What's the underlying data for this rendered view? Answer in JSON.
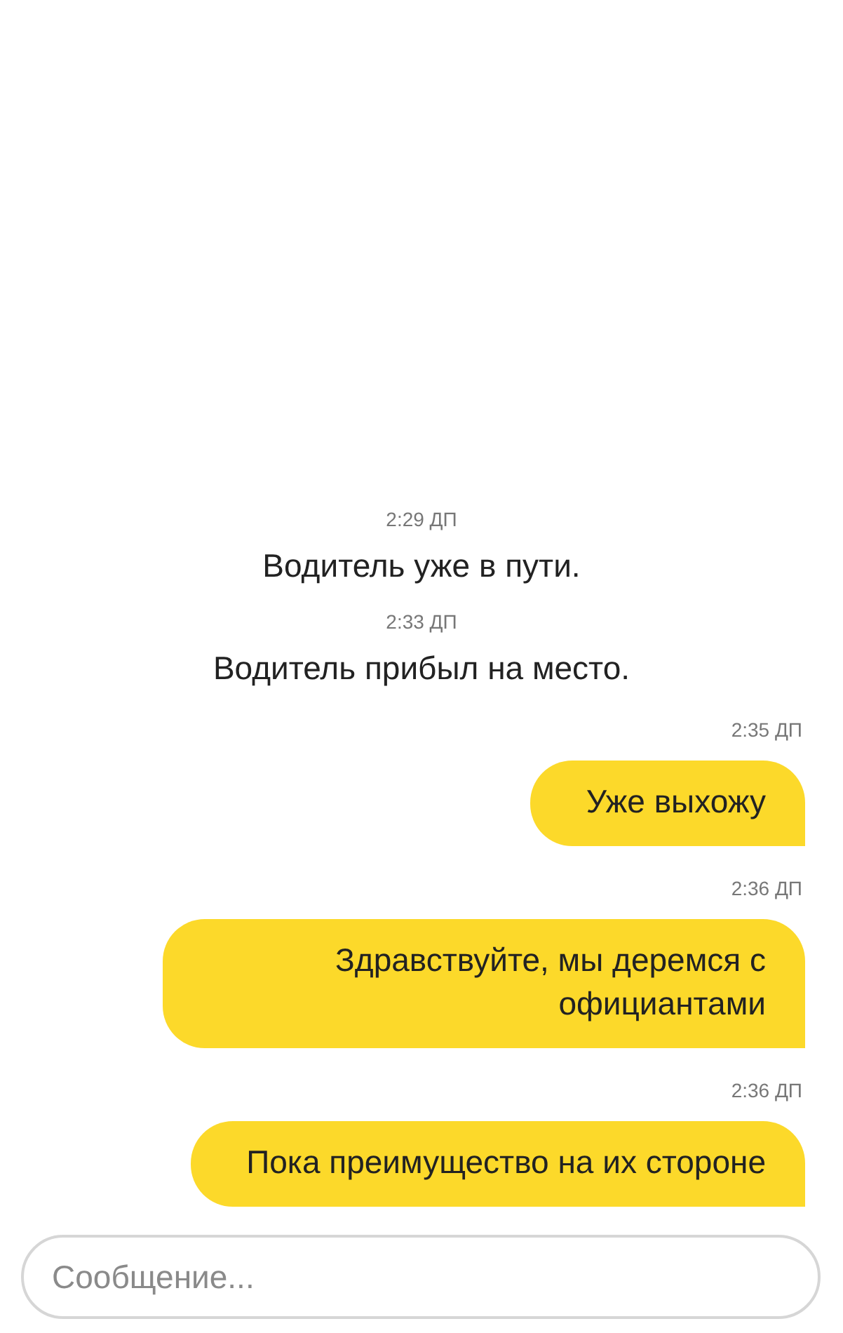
{
  "messages": [
    {
      "kind": "system",
      "time": "2:29 ДП",
      "text": "Водитель уже в пути."
    },
    {
      "kind": "system",
      "time": "2:33 ДП",
      "text": "Водитель прибыл на место."
    },
    {
      "kind": "outgoing",
      "time": "2:35 ДП",
      "text": "Уже выхожу"
    },
    {
      "kind": "outgoing",
      "time": "2:36 ДП",
      "text": "Здравствуйте, мы деремся с официантами"
    },
    {
      "kind": "outgoing",
      "time": "2:36 ДП",
      "text": "Пока преимущество на их стороне"
    }
  ],
  "composer": {
    "placeholder": "Сообщение..."
  }
}
